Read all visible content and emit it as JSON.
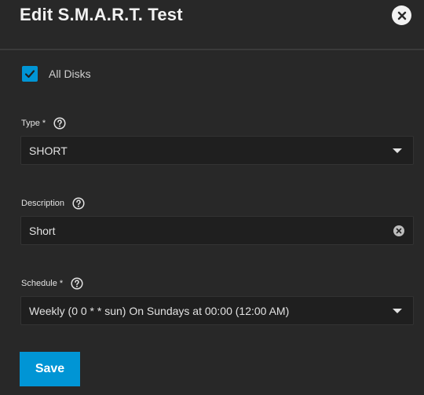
{
  "dialog": {
    "title": "Edit S.M.A.R.T. Test"
  },
  "all_disks": {
    "label": "All Disks",
    "checked": true
  },
  "type_field": {
    "label": "Type *",
    "value": "SHORT"
  },
  "description_field": {
    "label": "Description",
    "value": "Short"
  },
  "schedule_field": {
    "label": "Schedule *",
    "value": "Weekly (0 0 * * sun)  On Sundays at 00:00 (12:00 AM)"
  },
  "actions": {
    "save_label": "Save"
  },
  "colors": {
    "background": "#282828",
    "field_background": "#1f1f1f",
    "accent": "#0095d5",
    "text": "#e2e2e2"
  },
  "icons": {
    "close": "close-circle-icon",
    "help": "help-circle-icon",
    "checkmark": "check-icon",
    "dropdown": "caret-down-icon",
    "clear": "clear-circle-icon"
  }
}
